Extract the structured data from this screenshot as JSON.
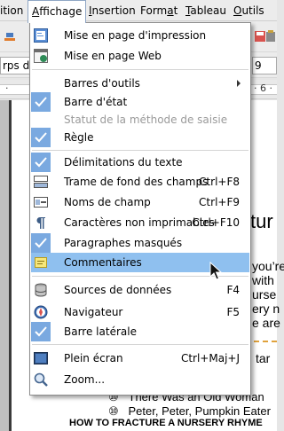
{
  "menubar": {
    "items": [
      {
        "label": "ition"
      },
      {
        "label": "Affichage",
        "mnemonic": "A",
        "rest": "ffichage"
      },
      {
        "label": "Insertion",
        "mnemonic": "I",
        "rest": "nsertion"
      },
      {
        "label": "Format",
        "pre": "Form",
        "mnemonic": "a",
        "post": "t"
      },
      {
        "label": "Tableau",
        "mnemonic": "T",
        "rest": "ableau"
      },
      {
        "label": "Outils",
        "mnemonic": "O",
        "rest": "utils"
      }
    ]
  },
  "toolbar": {
    "style_field": "rps de",
    "size_field": "9",
    "ruler_right": "· 6 ·"
  },
  "document": {
    "heading_fragment": "tur",
    "lines": [
      "you’re",
      "with",
      "urse",
      "ery n",
      "e are"
    ],
    "star_fragment": "tar",
    "list": [
      {
        "bullet": "⑩",
        "text": "There Was an Old Woman"
      },
      {
        "bullet": "⑩",
        "text": "Peter, Peter, Pumpkin Eater"
      }
    ],
    "footer": "HOW TO FRACTURE A NURSERY RHYME"
  },
  "menu": {
    "items": [
      {
        "key": "print_layout",
        "label": "Mise en page d'impression",
        "icon": "print-layout-icon",
        "shortcut": ""
      },
      {
        "key": "web_layout",
        "label": "Mise en page Web",
        "icon": "web-layout-icon",
        "shortcut": ""
      },
      {
        "key": "toolbars",
        "label": "Barres d'outils",
        "submenu": true,
        "shortcut": ""
      },
      {
        "key": "status_bar",
        "label": "Barre d'état",
        "checked": true,
        "shortcut": ""
      },
      {
        "key": "ime_status",
        "label": "Statut de la méthode de saisie",
        "disabled": true,
        "shortcut": ""
      },
      {
        "key": "ruler",
        "label": "Règle",
        "checked": true,
        "shortcut": ""
      },
      {
        "key": "text_boundaries",
        "label": "Délimitations du texte",
        "checked": true,
        "shortcut": ""
      },
      {
        "key": "field_shadings",
        "label": "Trame de fond des champs",
        "icon": "field-shadings-icon",
        "shortcut": "Ctrl+F8"
      },
      {
        "key": "field_names",
        "label": "Noms de champ",
        "icon": "field-names-icon",
        "shortcut": "Ctrl+F9"
      },
      {
        "key": "nonprinting",
        "label": "Caractères non imprimables",
        "icon": "pilcrow-icon",
        "shortcut": "Ctrl+F10"
      },
      {
        "key": "hidden_paragraphs",
        "label": "Paragraphes masqués",
        "checked": true,
        "shortcut": ""
      },
      {
        "key": "comments",
        "label": "Commentaires",
        "icon": "comment-icon",
        "shortcut": "",
        "highlighted": true
      },
      {
        "key": "data_sources",
        "label": "Sources de données",
        "icon": "database-icon",
        "shortcut": "F4"
      },
      {
        "key": "navigator",
        "label": "Navigateur",
        "icon": "compass-icon",
        "shortcut": "F5"
      },
      {
        "key": "sidebar",
        "label": "Barre latérale",
        "checked": true,
        "shortcut": ""
      },
      {
        "key": "full_screen",
        "label": "Plein écran",
        "icon": "full-screen-icon",
        "shortcut": "Ctrl+Maj+J"
      },
      {
        "key": "zoom",
        "label": "Zoom...",
        "icon": "zoom-icon",
        "shortcut": ""
      }
    ]
  },
  "colors": {
    "highlight": "#8fc0ef",
    "check_bg": "#7aa9e0",
    "disabled_text": "#9a9a9a"
  }
}
